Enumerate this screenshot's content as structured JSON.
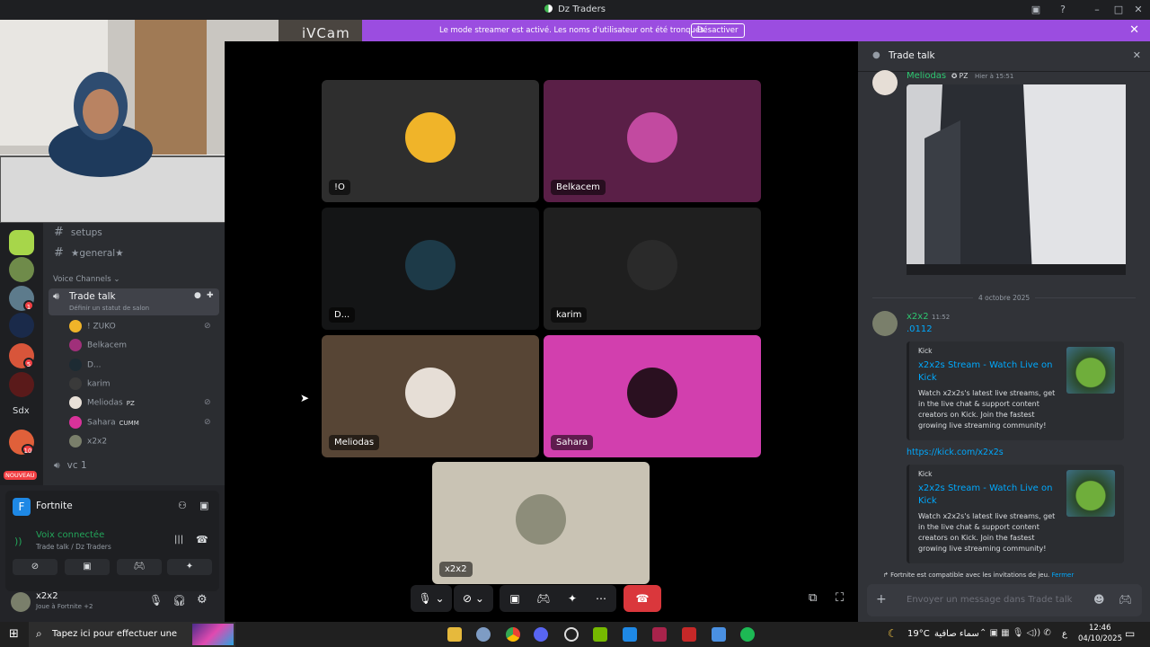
{
  "window": {
    "title": "Dz Traders"
  },
  "banner": {
    "message": "Le mode streamer est activé. Les noms d'utilisateur ont été tronqués.",
    "button": "Désactiver"
  },
  "webcam": {
    "watermark": "iVCam"
  },
  "server_rail": {
    "badges": [
      "1",
      "5",
      "10"
    ],
    "text_server": "Sdx",
    "new_badge": "NOUVEAU"
  },
  "channels": {
    "text": [
      "setups",
      "★general★"
    ],
    "voice_header": "Voice Channels",
    "active_voice": {
      "name": "Trade talk",
      "status": "Définir un statut de salon"
    },
    "members": [
      {
        "name": "! ZUKO",
        "muted": true,
        "color": "#f0b429"
      },
      {
        "name": "Belkacem",
        "muted": false,
        "color": "#a0307a"
      },
      {
        "name": "D...",
        "muted": false,
        "color": "#1d2b33"
      },
      {
        "name": "karim",
        "muted": false,
        "color": "#3a3a3a"
      },
      {
        "name": "Meliodas",
        "tag": "PZ",
        "muted": true,
        "color": "#e8e0d8"
      },
      {
        "name": "Sahara",
        "tag": "CUMM",
        "muted": true,
        "color": "#d9329a"
      },
      {
        "name": "x2x2",
        "muted": false,
        "color": "#7a7f6b"
      }
    ],
    "other_voice": "vc 1"
  },
  "activity": {
    "game": "Fortnite",
    "voice_status": "Voix connectée",
    "voice_location": "Trade talk / Dz Traders",
    "user": "x2x2",
    "user_status": "Joue à Fortnite +2"
  },
  "stage": {
    "tiles": [
      {
        "label": "!O",
        "bg": "#2e2e2e",
        "avatar": "#f0b429"
      },
      {
        "label": "Belkacem",
        "bg": "#5a1f47",
        "avatar": "#c24aa0"
      },
      {
        "label": "D...",
        "bg": "#141516",
        "avatar": "#1d3a48"
      },
      {
        "label": "karim",
        "bg": "#1f1f1f",
        "avatar": "#2a2a2a"
      },
      {
        "label": "Meliodas",
        "bg": "#574535",
        "avatar": "#e6ded6"
      },
      {
        "label": "Sahara",
        "bg": "#d23fae",
        "avatar": "#2a1020"
      },
      {
        "label": "x2x2",
        "bg": "#c9c3b4",
        "avatar": "#8d8d7a"
      }
    ]
  },
  "chat": {
    "channel": "Trade talk",
    "msg1": {
      "author": "Meliodas",
      "tag": "PZ",
      "time": "Hier à 15:51"
    },
    "date_divider": "4 octobre 2025",
    "msg2": {
      "author": "x2x2",
      "time": "11:52",
      "text": ".0112"
    },
    "embed": {
      "provider": "Kick",
      "title": "x2x2s Stream - Watch Live on Kick",
      "description": "Watch x2x2s's latest live streams, get in the live chat & support content creators on Kick. Join the fastest growing live streaming community!"
    },
    "link": "https://kick.com/x2x2s",
    "invite_note": "Fortnite est compatible avec les invitations de jeu.",
    "invite_close": "Fermer",
    "input_placeholder": "Envoyer un message dans Trade talk"
  },
  "taskbar": {
    "search_placeholder": "Tapez ici pour effectuer une",
    "weather_temp": "19°C",
    "weather_desc": "سماء صافية",
    "lang": "ع",
    "time": "12:46",
    "date": "04/10/2025"
  },
  "colors": {
    "discord_bg": "#313338",
    "banner": "#9b4de0",
    "green": "#23a55a",
    "link": "#00a8fc"
  }
}
